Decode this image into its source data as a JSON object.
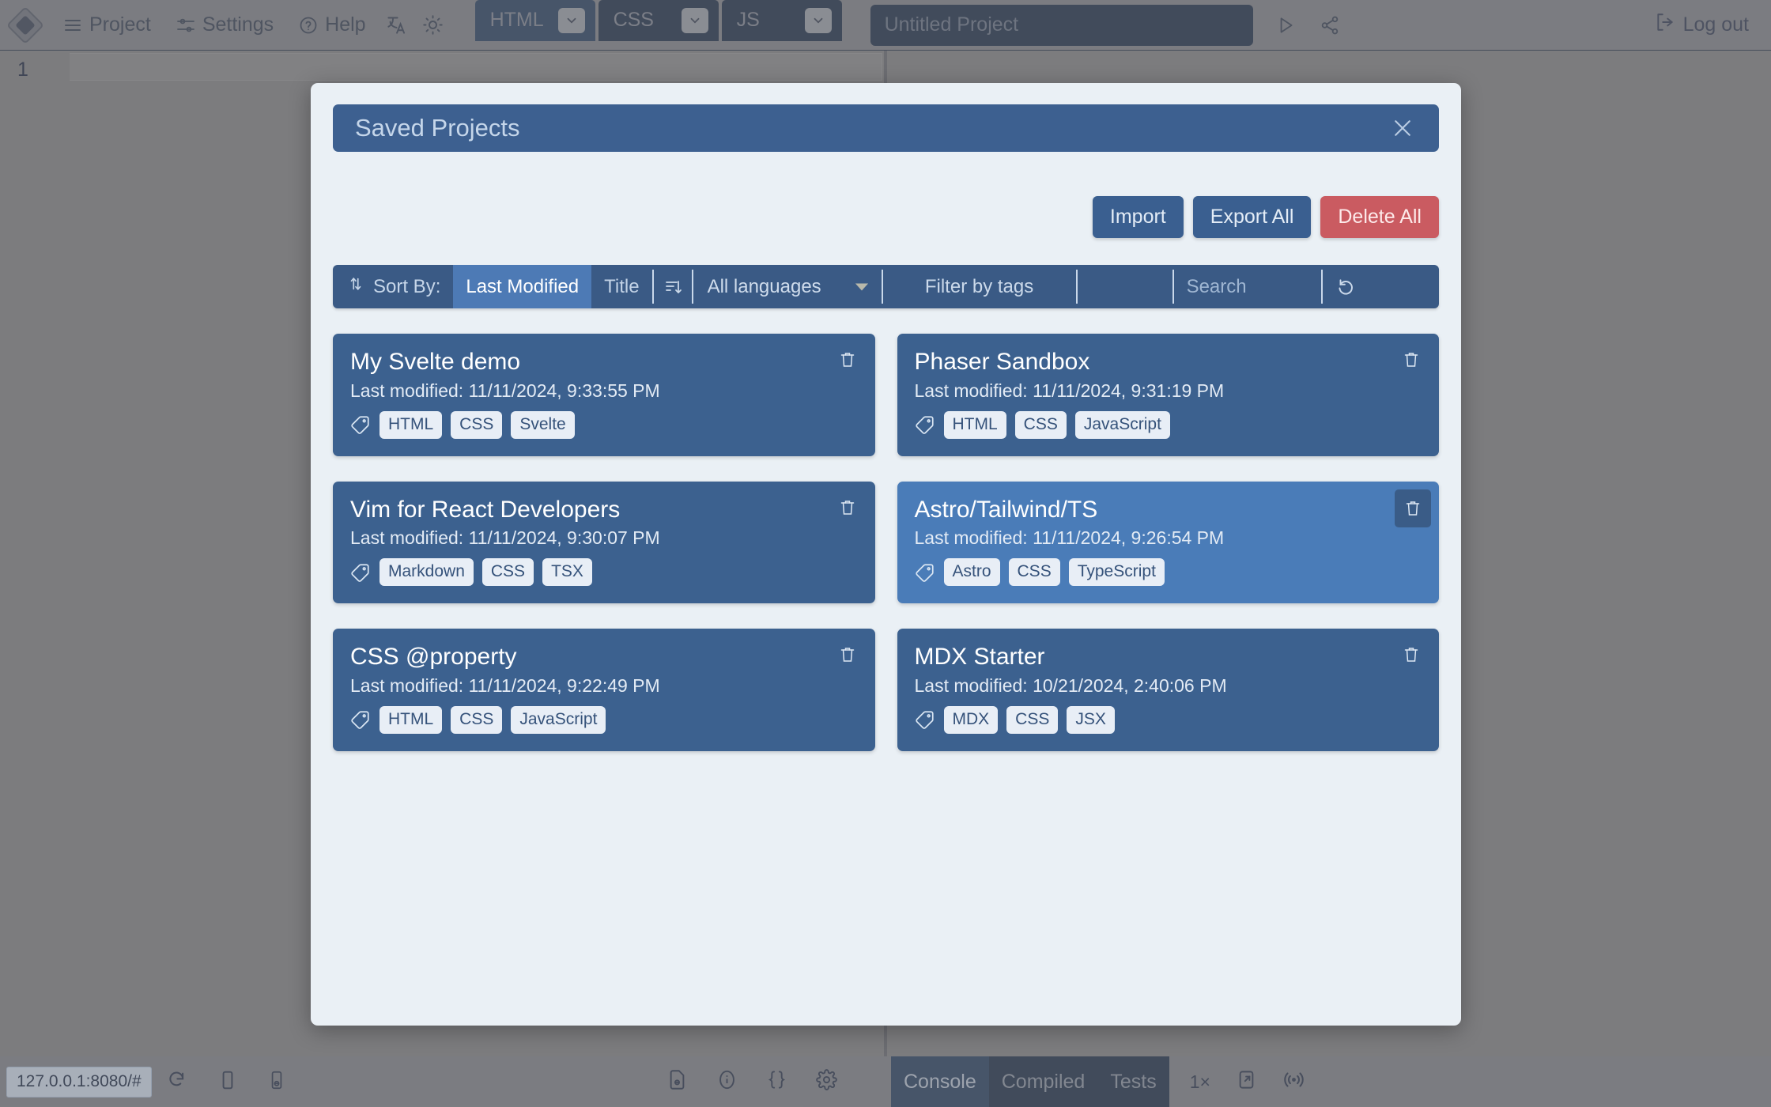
{
  "topbar": {
    "logo": "app-logo",
    "menus": [
      {
        "label": "Project",
        "icon": "hamburger-icon"
      },
      {
        "label": "Settings",
        "icon": "sliders-icon"
      },
      {
        "label": "Help",
        "icon": "question-circle-icon"
      }
    ],
    "translate_icon": "translate-icon",
    "theme_icon": "sun-icon",
    "lang_tabs": [
      {
        "label": "HTML"
      },
      {
        "label": "CSS"
      },
      {
        "label": "JS"
      }
    ],
    "project_name_placeholder": "Untitled Project",
    "project_name_value": "",
    "run_icon": "play-icon",
    "share_icon": "share-icon",
    "logout_label": "Log out",
    "logout_icon": "logout-icon"
  },
  "editor": {
    "line_number": "1"
  },
  "modal": {
    "title": "Saved Projects",
    "close_icon": "close-icon",
    "actions": {
      "import": "Import",
      "export_all": "Export All",
      "delete_all": "Delete All"
    },
    "filter_bar": {
      "sort_icon": "sort-arrows-icon",
      "sort_label": "Sort By:",
      "sort_options": [
        {
          "label": "Last Modified",
          "selected": true
        },
        {
          "label": "Title",
          "selected": false
        }
      ],
      "sort_direction_icon": "sort-descending-icon",
      "language_select": "All languages",
      "language_chevron_icon": "chevron-down-icon",
      "tags_label": "Filter by tags",
      "tags_input_value": "",
      "search_placeholder": "Search",
      "search_value": "",
      "refresh_icon": "refresh-icon"
    },
    "projects": [
      {
        "title": "My Svelte demo",
        "modified": "Last modified: 11/11/2024, 9:33:55 PM",
        "tags": [
          "HTML",
          "CSS",
          "Svelte"
        ],
        "hovered": false
      },
      {
        "title": "Phaser Sandbox",
        "modified": "Last modified: 11/11/2024, 9:31:19 PM",
        "tags": [
          "HTML",
          "CSS",
          "JavaScript"
        ],
        "hovered": false
      },
      {
        "title": "Vim for React Developers",
        "modified": "Last modified: 11/11/2024, 9:30:07 PM",
        "tags": [
          "Markdown",
          "CSS",
          "TSX"
        ],
        "hovered": false
      },
      {
        "title": "Astro/Tailwind/TS",
        "modified": "Last modified: 11/11/2024, 9:26:54 PM",
        "tags": [
          "Astro",
          "CSS",
          "TypeScript"
        ],
        "hovered": true
      },
      {
        "title": "CSS @property",
        "modified": "Last modified: 11/11/2024, 9:22:49 PM",
        "tags": [
          "HTML",
          "CSS",
          "JavaScript"
        ],
        "hovered": false
      },
      {
        "title": "MDX Starter",
        "modified": "Last modified: 10/21/2024, 2:40:06 PM",
        "tags": [
          "MDX",
          "CSS",
          "JSX"
        ],
        "hovered": false
      }
    ]
  },
  "bottombar": {
    "status_url": "127.0.0.1:8080/#",
    "left_icons": [
      "reload-icon",
      "phone-portrait-icon",
      "phone-landscape-icon"
    ],
    "mid_icons": [
      "file-code-icon",
      "info-icon",
      "braces-icon",
      "gear-icon"
    ],
    "console_tabs": [
      {
        "label": "Console",
        "active": true
      },
      {
        "label": "Compiled",
        "active": false
      },
      {
        "label": "Tests",
        "active": false
      }
    ],
    "zoom_label": "1×",
    "right_icons": [
      "open-external-icon",
      "broadcast-icon"
    ]
  },
  "colors": {
    "accent_blue": "#3a5f90",
    "card_blue": "#3c618f",
    "card_blue_hover": "#4a7cb8",
    "danger_red": "#ca5b61",
    "modal_bg": "#eaf0f5",
    "chrome_gray": "#8a8d93"
  }
}
